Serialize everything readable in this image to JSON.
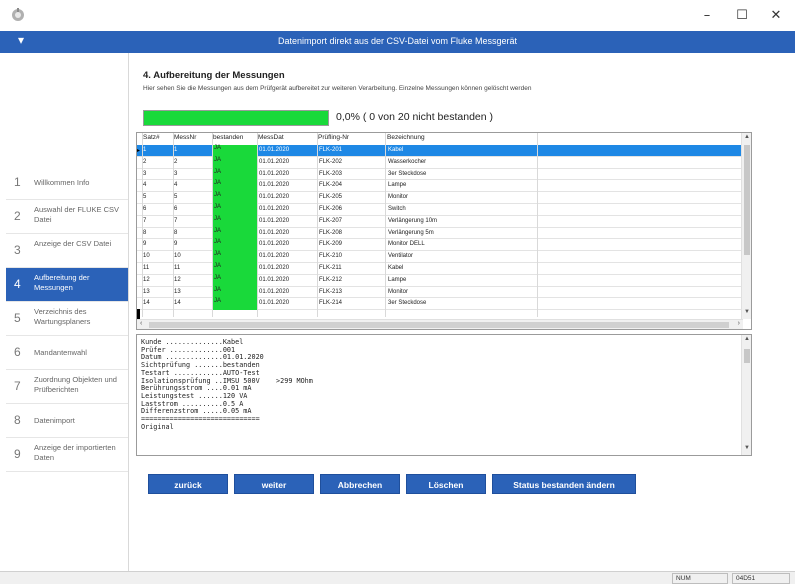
{
  "window": {
    "minimize": "–",
    "maximize": "☐",
    "close": "✕"
  },
  "header": {
    "title": "Datenimport direkt aus der CSV-Datei vom Fluke Messgerät",
    "chevron": "▾"
  },
  "sidebar": {
    "items": [
      {
        "num": "1",
        "label": "Willkommen Info",
        "active": false
      },
      {
        "num": "2",
        "label": "Auswahl der FLUKE CSV Datei",
        "active": false
      },
      {
        "num": "3",
        "label": "Anzeige der CSV Datei",
        "active": false
      },
      {
        "num": "4",
        "label": "Aufbereitung der Messungen",
        "active": true
      },
      {
        "num": "5",
        "label": "Verzeichnis des Wartungsplaners",
        "active": false
      },
      {
        "num": "6",
        "label": "Mandantenwahl",
        "active": false
      },
      {
        "num": "7",
        "label": "Zuordnung Objekten und Prüfberichten",
        "active": false
      },
      {
        "num": "8",
        "label": "Datenimport",
        "active": false
      },
      {
        "num": "9",
        "label": "Anzeige der importierten Daten",
        "active": false
      }
    ]
  },
  "main": {
    "title": "4. Aufbereitung der Messungen",
    "description": "Hier sehen Sie die Messungen aus dem Prüfgerät aufbereitet zur weiteren Verarbeitung. Einzelne Messungen können gelöscht werden",
    "progress_text": "0,0%  ( 0 von 20 nicht bestanden )",
    "progress_fraction": 0.0
  },
  "table": {
    "columns": [
      "Satz#",
      "MessNr",
      "bestanden",
      "MessDat",
      "Prüfling-Nr",
      "Bezeichnung"
    ],
    "rows": [
      [
        "1",
        "1",
        "JA",
        "01.01.2020",
        "FLK-201",
        "Kabel"
      ],
      [
        "2",
        "2",
        "JA",
        "01.01.2020",
        "FLK-202",
        "Wasserkocher"
      ],
      [
        "3",
        "3",
        "JA",
        "01.01.2020",
        "FLK-203",
        "3er Steckdose"
      ],
      [
        "4",
        "4",
        "JA",
        "01.01.2020",
        "FLK-204",
        "Lampe"
      ],
      [
        "5",
        "5",
        "JA",
        "01.01.2020",
        "FLK-205",
        "Monitor"
      ],
      [
        "6",
        "6",
        "JA",
        "01.01.2020",
        "FLK-206",
        "Switch"
      ],
      [
        "7",
        "7",
        "JA",
        "01.01.2020",
        "FLK-207",
        "Verlängerung 10m"
      ],
      [
        "8",
        "8",
        "JA",
        "01.01.2020",
        "FLK-208",
        "Verlängerung 5m"
      ],
      [
        "9",
        "9",
        "JA",
        "01.01.2020",
        "FLK-209",
        "Monitor DELL"
      ],
      [
        "10",
        "10",
        "JA",
        "01.01.2020",
        "FLK-210",
        "Ventilator"
      ],
      [
        "11",
        "11",
        "JA",
        "01.01.2020",
        "FLK-211",
        "Kabel"
      ],
      [
        "12",
        "12",
        "JA",
        "01.01.2020",
        "FLK-212",
        "Lampe"
      ],
      [
        "13",
        "13",
        "JA",
        "01.01.2020",
        "FLK-213",
        "Monitor"
      ],
      [
        "14",
        "14",
        "JA",
        "01.01.2020",
        "FLK-214",
        "3er Steckdose"
      ]
    ],
    "selected_row": 0
  },
  "details": {
    "text": "Kunde ..............Kabel\nPrüfer .............001\nDatum ..............01.01.2020\nSichtprüfung .......bestanden\nTestart ............AUTO-Test\nIsolationsprüfung ..IMSU 500V    >299 MOhm\nBerührungsstrom ....0.01 mA\nLeistungstest ......120 VA\nLaststrom ..........0.5 A\nDifferenzstrom .....0.05 mA\n=============================\nOriginal"
  },
  "buttons": {
    "back": "zurück",
    "next": "weiter",
    "cancel": "Abbrechen",
    "delete": "Löschen",
    "toggle_status": "Status bestanden ändern"
  },
  "statusbar": {
    "num": "NUM",
    "time": "04D51"
  },
  "colors": {
    "accent": "#2b62b8",
    "selection": "#1e88e5",
    "pass": "#19d93a"
  }
}
